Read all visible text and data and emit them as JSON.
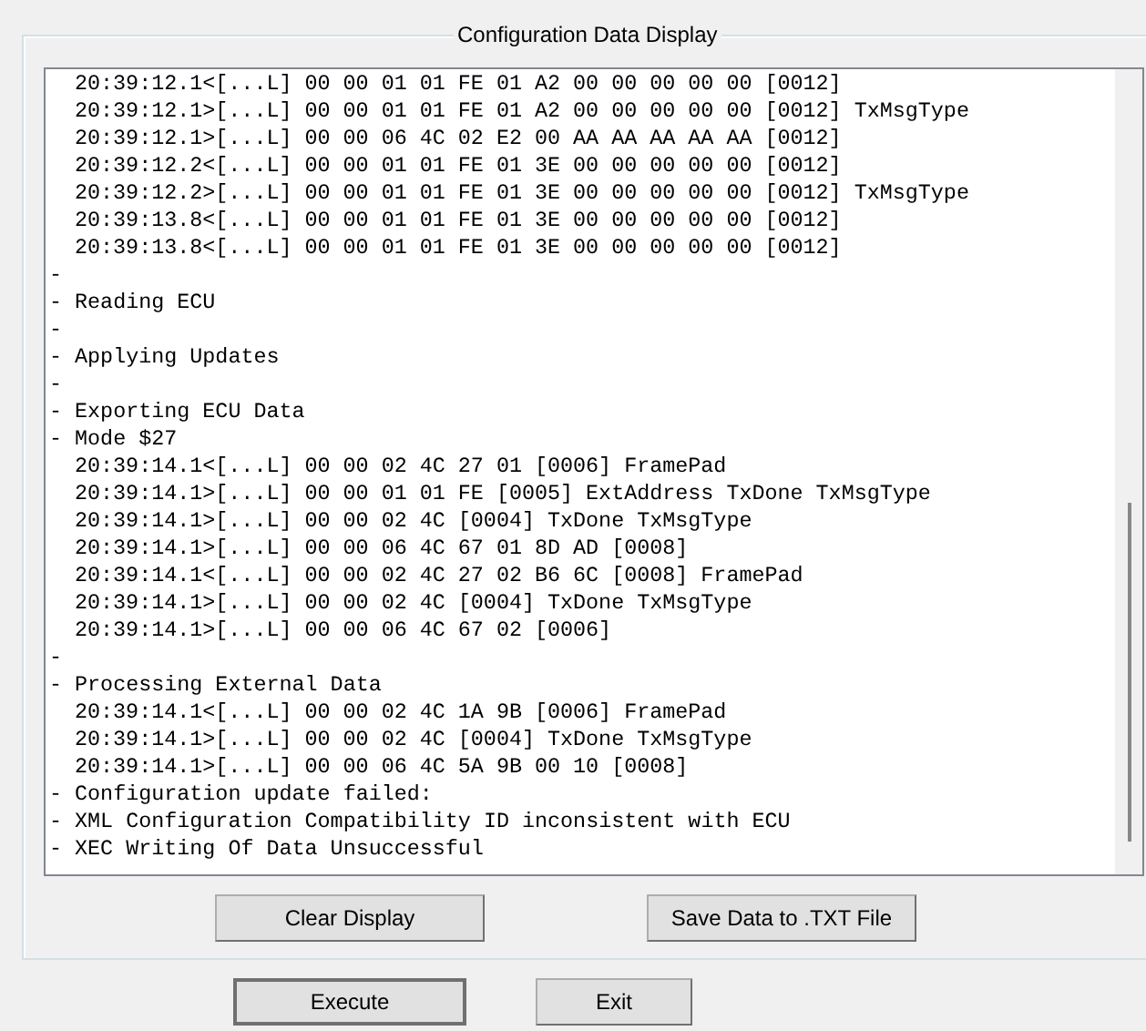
{
  "group_title": "Configuration Data Display",
  "log_lines": [
    {
      "kind": "message",
      "text": "20:39:12.1<[...L] 00 00 01 01 FE 01 A2 00 00 00 00 00 [0012]"
    },
    {
      "kind": "message",
      "text": "20:39:12.1>[...L] 00 00 01 01 FE 01 A2 00 00 00 00 00 [0012] TxMsgType"
    },
    {
      "kind": "message",
      "text": "20:39:12.1>[...L] 00 00 06 4C 02 E2 00 AA AA AA AA AA [0012]"
    },
    {
      "kind": "message",
      "text": "20:39:12.2<[...L] 00 00 01 01 FE 01 3E 00 00 00 00 00 [0012]"
    },
    {
      "kind": "message",
      "text": "20:39:12.2>[...L] 00 00 01 01 FE 01 3E 00 00 00 00 00 [0012] TxMsgType"
    },
    {
      "kind": "message",
      "text": "20:39:13.8<[...L] 00 00 01 01 FE 01 3E 00 00 00 00 00 [0012]"
    },
    {
      "kind": "message",
      "text": "20:39:13.8<[...L] 00 00 01 01 FE 01 3E 00 00 00 00 00 [0012]"
    },
    {
      "kind": "status",
      "text": "-"
    },
    {
      "kind": "status",
      "text": "- Reading ECU"
    },
    {
      "kind": "status",
      "text": "-"
    },
    {
      "kind": "status",
      "text": "- Applying Updates"
    },
    {
      "kind": "status",
      "text": "-"
    },
    {
      "kind": "status",
      "text": "- Exporting ECU Data"
    },
    {
      "kind": "status",
      "text": "- Mode $27"
    },
    {
      "kind": "message",
      "text": "20:39:14.1<[...L] 00 00 02 4C 27 01 [0006] FramePad"
    },
    {
      "kind": "message",
      "text": "20:39:14.1>[...L] 00 00 01 01 FE [0005] ExtAddress TxDone TxMsgType"
    },
    {
      "kind": "message",
      "text": "20:39:14.1>[...L] 00 00 02 4C [0004] TxDone TxMsgType"
    },
    {
      "kind": "message",
      "text": "20:39:14.1>[...L] 00 00 06 4C 67 01 8D AD [0008]"
    },
    {
      "kind": "message",
      "text": "20:39:14.1<[...L] 00 00 02 4C 27 02 B6 6C [0008] FramePad"
    },
    {
      "kind": "message",
      "text": "20:39:14.1>[...L] 00 00 02 4C [0004] TxDone TxMsgType"
    },
    {
      "kind": "message",
      "text": "20:39:14.1>[...L] 00 00 06 4C 67 02 [0006]"
    },
    {
      "kind": "status",
      "text": "-"
    },
    {
      "kind": "status",
      "text": "- Processing External Data"
    },
    {
      "kind": "message",
      "text": "20:39:14.1<[...L] 00 00 02 4C 1A 9B [0006] FramePad"
    },
    {
      "kind": "message",
      "text": "20:39:14.1>[...L] 00 00 02 4C [0004] TxDone TxMsgType"
    },
    {
      "kind": "message",
      "text": "20:39:14.1>[...L] 00 00 06 4C 5A 9B 00 10 [0008]"
    },
    {
      "kind": "status",
      "text": "- Configuration update failed:"
    },
    {
      "kind": "status",
      "text": "- XML Configuration Compatibility ID inconsistent with ECU"
    },
    {
      "kind": "status",
      "text": "- XEC Writing Of Data Unsuccessful"
    }
  ],
  "group_buttons": [
    "Clear Display",
    "Save Data to .TXT File"
  ],
  "buttons": [
    "Execute",
    "Exit"
  ]
}
